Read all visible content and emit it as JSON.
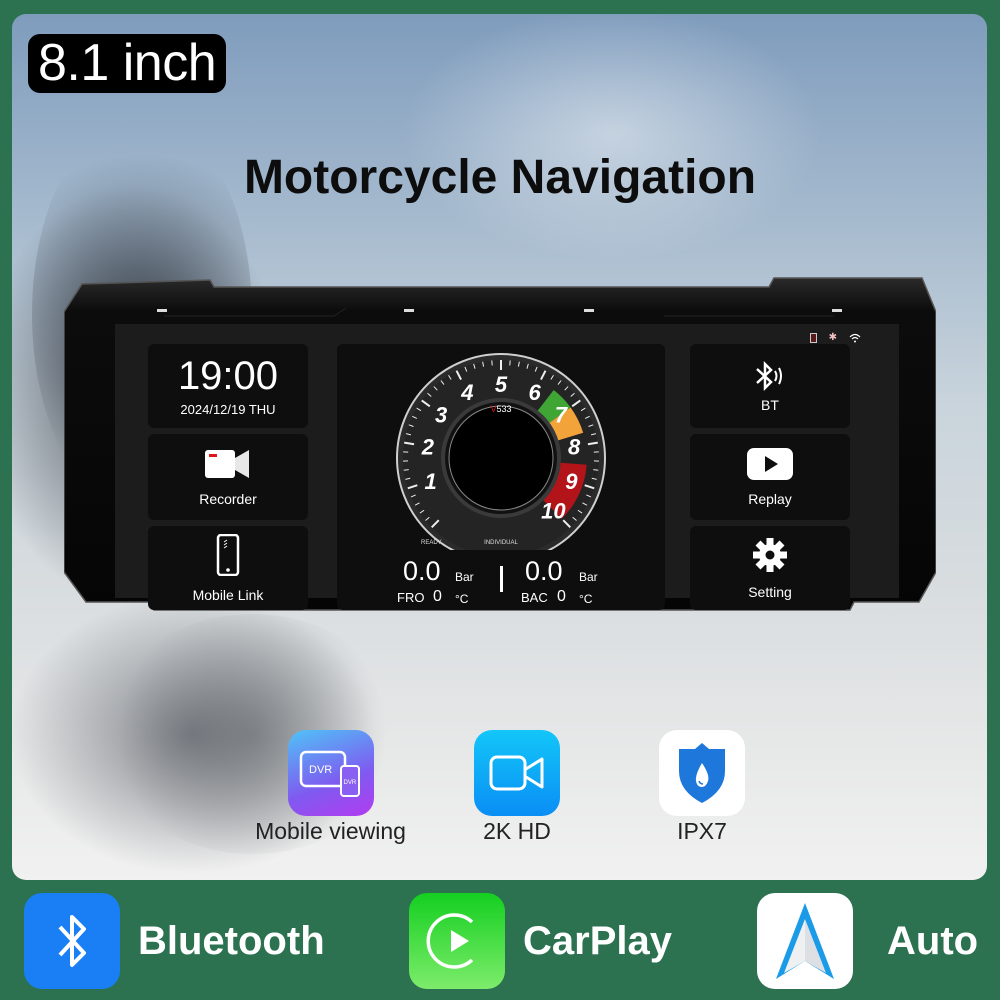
{
  "badge": {
    "text": "8.1 inch"
  },
  "headline": {
    "text": "Motorcycle Navigation"
  },
  "device": {
    "status_icons": [
      "phone-status-icon",
      "bluetooth-signal-icon",
      "wifi-icon"
    ],
    "clock": {
      "time": "19:00",
      "date": "2024/12/19 THU"
    },
    "left_tiles": [
      {
        "label": "Recorder",
        "icon": "video-camera-icon",
        "accent": "#e0141b"
      },
      {
        "label": "Mobile Link",
        "icon": "smartphone-icon"
      }
    ],
    "right_tiles": [
      {
        "label": "BT",
        "icon": "bluetooth-icon"
      },
      {
        "label": "Replay",
        "icon": "play-icon"
      },
      {
        "label": "Setting",
        "icon": "gear-icon"
      }
    ],
    "gauge": {
      "ticks": [
        "1",
        "2",
        "3",
        "4",
        "5",
        "6",
        "7",
        "8",
        "9",
        "10"
      ],
      "model_prefix": "V",
      "model_number": "533",
      "mode_left": "READY",
      "mode_center": "INDIVIDUAL",
      "zone_colors": {
        "green": "#3fa535",
        "orange": "#f2a33a",
        "red": "#b3141a"
      }
    },
    "tire_front": {
      "label": "FRO",
      "pressure": "0.0",
      "pressure_unit": "Bar",
      "temp": "0",
      "temp_unit": "°C"
    },
    "tire_back": {
      "label": "BAC",
      "pressure": "0.0",
      "pressure_unit": "Bar",
      "temp": "0",
      "temp_unit": "°C"
    }
  },
  "features": [
    {
      "label": "Mobile viewing",
      "icon": "dvr-mobile-icon",
      "big_text": "DVR",
      "small_text": "DVR"
    },
    {
      "label": "2K HD",
      "icon": "video-camera-icon"
    },
    {
      "label": "IPX7",
      "icon": "waterproof-shield-icon"
    }
  ],
  "bottom_bar": [
    {
      "label": "Bluetooth",
      "icon": "bluetooth-icon",
      "color": "#1a7ef5"
    },
    {
      "label": "CarPlay",
      "icon": "carplay-icon",
      "color": "#2fd12f"
    },
    {
      "label": "Auto",
      "icon": "android-auto-icon",
      "color": "#1a9be8"
    }
  ],
  "colors": {
    "background_green": "#2c7150",
    "badge_bg": "#000000"
  }
}
